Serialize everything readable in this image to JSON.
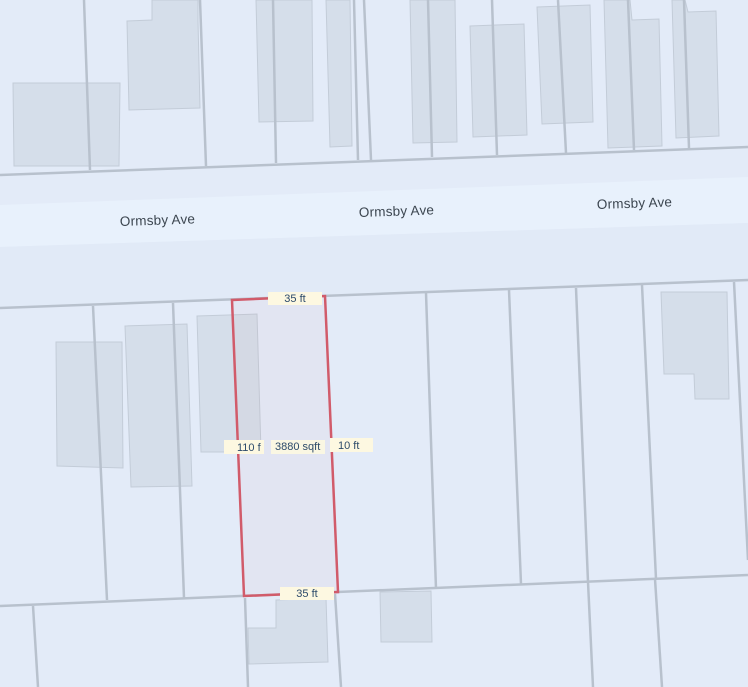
{
  "map": {
    "street_name": "Ormsby Ave",
    "colors": {
      "background": "#e3ebf8",
      "road": "#e7f0fc",
      "lot_line": "#b9c2ce",
      "building": "#d6dfeb",
      "building_edge": "#c3ccd8",
      "parcel_outline": "#d15b6a",
      "label_bg": "#fdf8e1"
    }
  },
  "parcel": {
    "top_width": "35 ft",
    "bottom_width": "35 ft",
    "left_depth": "110 f",
    "right_depth": "10 ft",
    "area": "3880 sqft"
  }
}
